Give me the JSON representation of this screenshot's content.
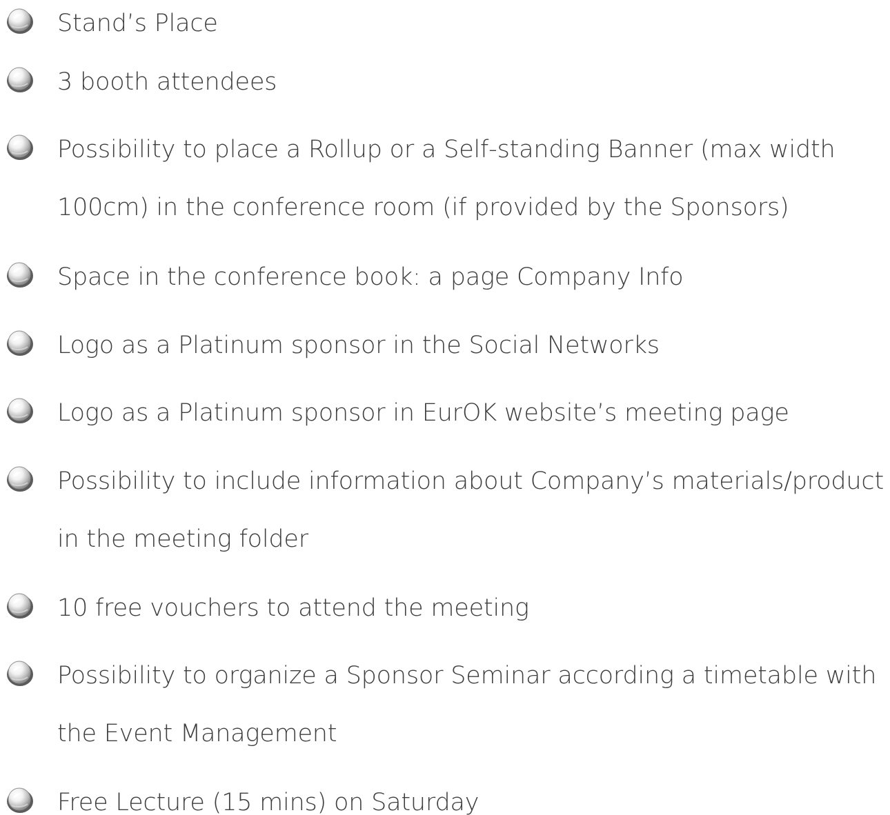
{
  "benefits_list": {
    "items": [
      {
        "text": "Stand’s Place",
        "icon": "pearl-bullet-icon"
      },
      {
        "text": "3 booth attendees",
        "icon": "pearl-bullet-icon"
      },
      {
        "text": "Possibility to place a Rollup or a Self-standing Banner (max width\n100cm) in the conference room (if provided by the Sponsors)",
        "icon": "pearl-bullet-icon"
      },
      {
        "text": "Space in the conference book: a page Company Info",
        "icon": "pearl-bullet-icon"
      },
      {
        "text": "Logo as a Platinum sponsor in the Social Networks",
        "icon": "pearl-bullet-icon"
      },
      {
        "text": "Logo as a Platinum sponsor in EurOK website’s meeting page",
        "icon": "pearl-bullet-icon"
      },
      {
        "text": "Possibility to include information about Company’s materials/product\nin the meeting folder",
        "icon": "pearl-bullet-icon"
      },
      {
        "text": "10 free vouchers to attend the meeting",
        "icon": "pearl-bullet-icon"
      },
      {
        "text": "Possibility to organize a Sponsor Seminar according a timetable with\nthe Event Management",
        "icon": "pearl-bullet-icon"
      },
      {
        "text": "Free Lecture (15 mins) on Saturday",
        "icon": "pearl-bullet-icon"
      }
    ]
  }
}
